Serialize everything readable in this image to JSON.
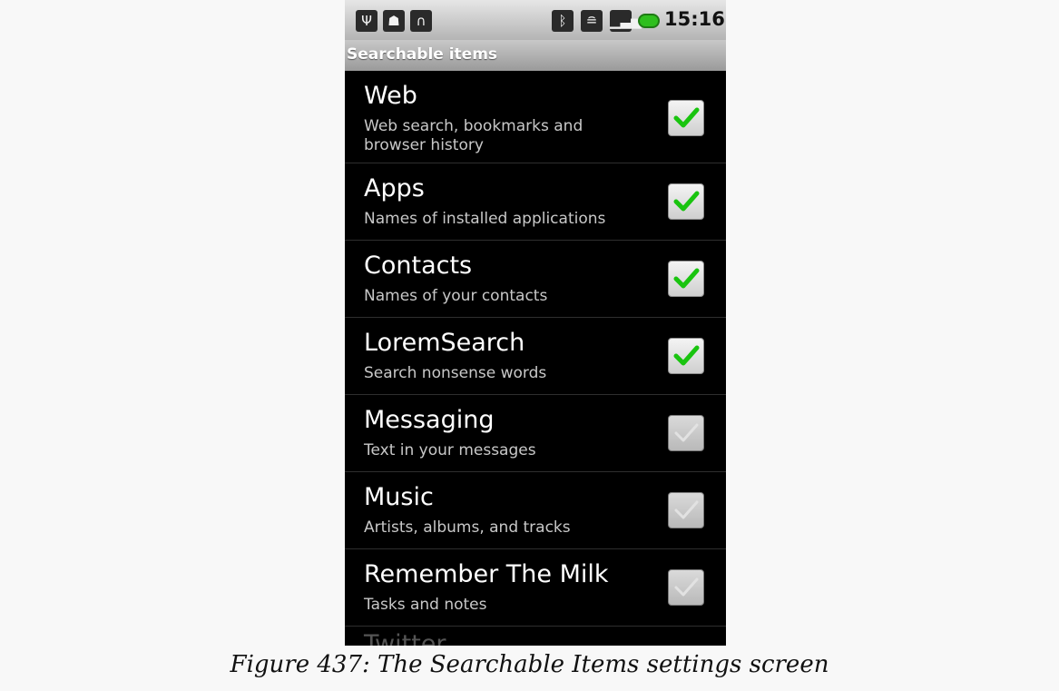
{
  "status_bar": {
    "left_icons": [
      "usb-icon",
      "android-debug-icon",
      "headphones-icon"
    ],
    "right_icons": [
      "bluetooth-icon",
      "wifi-icon",
      "signal-icon",
      "battery-icon"
    ],
    "time": "15:16"
  },
  "screen": {
    "title": "Searchable items"
  },
  "items": [
    {
      "title": "Web",
      "subtitle": "Web search, bookmarks and browser history",
      "checked": true,
      "enabled": true
    },
    {
      "title": "Apps",
      "subtitle": "Names of installed applications",
      "checked": true,
      "enabled": true
    },
    {
      "title": "Contacts",
      "subtitle": "Names of your contacts",
      "checked": true,
      "enabled": true
    },
    {
      "title": "LoremSearch",
      "subtitle": "Search nonsense words",
      "checked": true,
      "enabled": true
    },
    {
      "title": "Messaging",
      "subtitle": "Text in your messages",
      "checked": true,
      "enabled": false
    },
    {
      "title": "Music",
      "subtitle": "Artists, albums, and tracks",
      "checked": true,
      "enabled": false
    },
    {
      "title": "Remember The Milk",
      "subtitle": "Tasks and notes",
      "checked": true,
      "enabled": false
    }
  ],
  "partial_item_title": "Twitter",
  "colors": {
    "check_enabled": "#19c40f",
    "check_disabled": "#e2e2e2",
    "background": "#000000"
  },
  "caption": "Figure 437: The Searchable Items settings screen"
}
